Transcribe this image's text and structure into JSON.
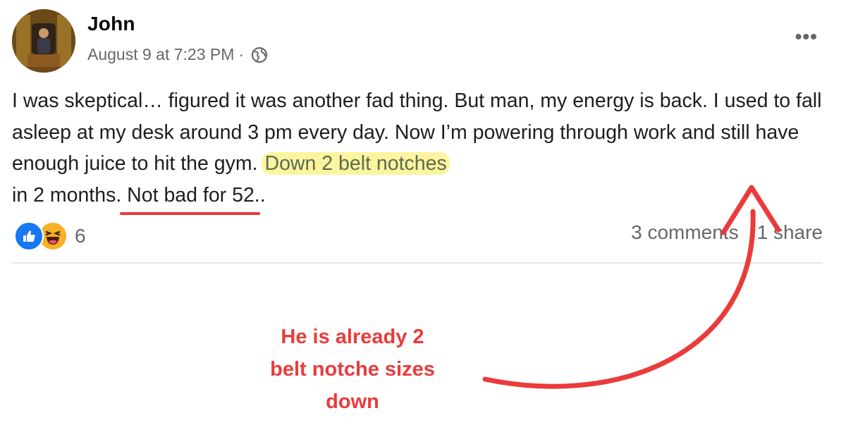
{
  "post": {
    "author": "John",
    "date": "August 9 at 7:23 PM",
    "separator": "·",
    "more_label": "•••",
    "text": {
      "part1": "I was skeptical… figured it was another fad thing. But man, my energy is back. I used to fall asleep at my desk around 3 pm every day. Now I’m powering through work and still have enough juice to hit the gym.",
      "highlighted": "Down 2 belt notches",
      "part2": "in 2 months.",
      "underlined": "Not bad for 52",
      "part3": ".."
    },
    "reaction_count": "6",
    "comments": "3 comments",
    "shares": "1 share",
    "icons": {
      "visibility": "globe-icon",
      "reactions": [
        "like-icon",
        "haha-icon"
      ]
    }
  },
  "annotation": {
    "line1": "He is already 2",
    "line2": "belt notche sizes",
    "line3": "down"
  },
  "colors": {
    "annotation_red": "#ea3b3b",
    "highlight_yellow": "#fbf5a0",
    "like_blue": "#1877f2",
    "haha_yellow": "#f7b125"
  }
}
